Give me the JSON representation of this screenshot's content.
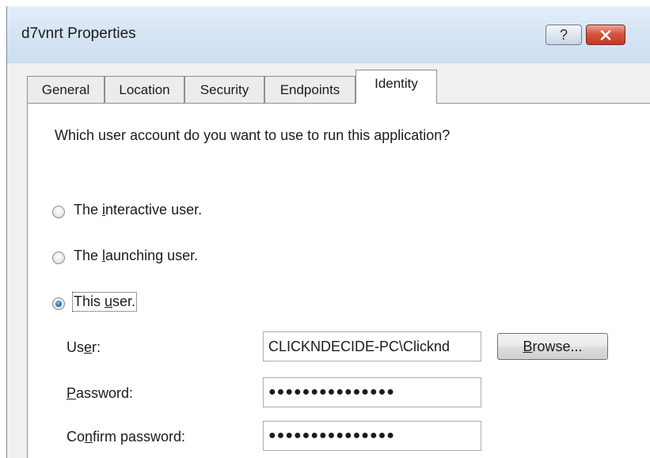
{
  "window": {
    "title": "d7vnrt Properties",
    "help_glyph": "?",
    "close_icon": "close-icon"
  },
  "tabs": [
    {
      "label": "General",
      "active": false
    },
    {
      "label": "Location",
      "active": false
    },
    {
      "label": "Security",
      "active": false
    },
    {
      "label": "Endpoints",
      "active": false
    },
    {
      "label": "Identity",
      "active": true
    }
  ],
  "identity": {
    "question": "Which user account do you want to use to run this application?",
    "options": [
      {
        "pre": "The ",
        "key": "i",
        "post": "nteractive user.",
        "checked": false
      },
      {
        "pre": "The ",
        "key": "l",
        "post": "aunching user.",
        "checked": false
      },
      {
        "pre": "This ",
        "key": "u",
        "post": "ser.",
        "checked": true
      }
    ],
    "user_label": {
      "pre": "Us",
      "key": "e",
      "post": "r:"
    },
    "password_label": {
      "pre": "",
      "key": "P",
      "post": "assword:"
    },
    "confirm_label": {
      "pre": "Co",
      "key": "n",
      "post": "firm password:"
    },
    "user_value": "CLICKNDECIDE-PC\\Clicknd",
    "password_value": "●●●●●●●●●●●●●●●",
    "confirm_value": "●●●●●●●●●●●●●●●",
    "browse_button": {
      "pre": "",
      "key": "B",
      "post": "rowse..."
    }
  },
  "colors": {
    "titlebar": "#d6e5f5",
    "close_button": "#c94a33",
    "radio_selected": "#1e6fc1"
  }
}
